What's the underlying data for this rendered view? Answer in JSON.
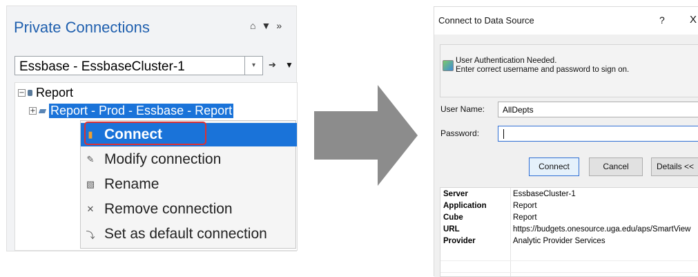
{
  "left_panel": {
    "title": "Private Connections",
    "toolbar_icons": [
      "home-icon",
      "dropdown-arrow-icon",
      "overflow-chevron-icon"
    ],
    "connection_select": {
      "value": "Essbase - EssbaseCluster-1"
    },
    "tree": {
      "root": {
        "label": "Report",
        "expander": "−"
      },
      "child": {
        "label": "Report - Prod - Essbase - Report",
        "expander": "+"
      }
    },
    "context_menu": [
      {
        "label": "Connect",
        "icon": "connect-icon",
        "glyph": "▮"
      },
      {
        "label": "Modify connection",
        "icon": "edit-icon",
        "glyph": "✎"
      },
      {
        "label": "Rename",
        "icon": "rename-icon",
        "glyph": "▧"
      },
      {
        "label": "Remove connection",
        "icon": "remove-icon",
        "glyph": "✕"
      },
      {
        "label": "Set as default connection",
        "icon": "default-connection-icon",
        "glyph": "⤵"
      }
    ]
  },
  "dialog": {
    "title": "Connect to Data Source",
    "help_glyph": "?",
    "close_glyph": "X",
    "auth_message_line1": "User Authentication Needed.",
    "auth_message_line2": "Enter correct username and password to sign on.",
    "username_label": "User Name:",
    "username_value": "AllDepts",
    "password_label": "Password:",
    "password_value": "",
    "buttons": {
      "connect": "Connect",
      "cancel": "Cancel",
      "details": "Details <<"
    },
    "info": [
      {
        "key": "Server",
        "value": "EssbaseCluster-1"
      },
      {
        "key": "Application",
        "value": "Report"
      },
      {
        "key": "Cube",
        "value": "Report"
      },
      {
        "key": "URL",
        "value": "https://budgets.onesource.uga.edu/aps/SmartView"
      },
      {
        "key": "Provider",
        "value": "Analytic Provider Services"
      }
    ]
  },
  "colors": {
    "title_blue": "#1f5fae",
    "selection_blue": "#1a73d9",
    "highlight_red": "#e03030",
    "arrow_gray": "#8c8c8c"
  }
}
